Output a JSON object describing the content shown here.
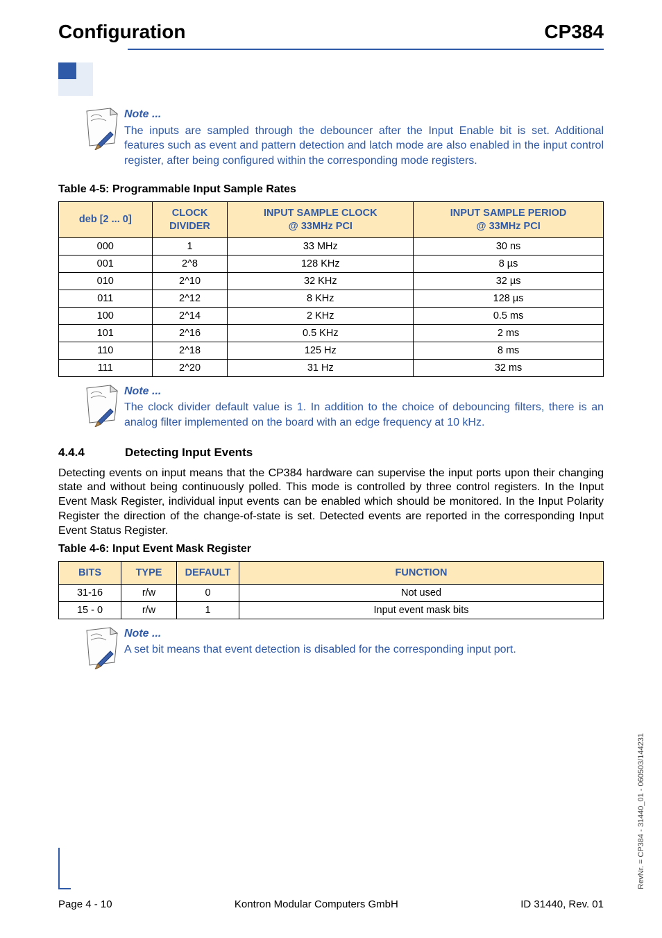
{
  "header": {
    "left": "Configuration",
    "right": "CP384"
  },
  "note1": {
    "head": "Note ...",
    "body": "The inputs are sampled through the debouncer after the Input Enable bit is set. Additional features such as event and pattern detection and latch mode are also enabled in the input control register, after being configured within the corresponding mode registers."
  },
  "table1": {
    "caption": "Table 4-5:  Programmable Input Sample Rates",
    "headers": [
      "deb [2 ... 0]",
      "CLOCK\nDIVIDER",
      "INPUT SAMPLE CLOCK\n@ 33MHz PCI",
      "INPUT SAMPLE PERIOD\n@ 33MHz PCI"
    ],
    "rows": [
      [
        "000",
        "1",
        "33 MHz",
        "30 ns"
      ],
      [
        "001",
        "2^8",
        "128 KHz",
        "8 µs"
      ],
      [
        "010",
        "2^10",
        "32 KHz",
        "32 µs"
      ],
      [
        "011",
        "2^12",
        "8 KHz",
        "128 µs"
      ],
      [
        "100",
        "2^14",
        "2 KHz",
        "0.5 ms"
      ],
      [
        "101",
        "2^16",
        "0.5 KHz",
        "2 ms"
      ],
      [
        "110",
        "2^18",
        "125 Hz",
        "8 ms"
      ],
      [
        "111",
        "2^20",
        "31 Hz",
        "32 ms"
      ]
    ]
  },
  "note2": {
    "head": "Note ...",
    "body": "The clock divider default value is 1. In addition to the choice of debouncing filters, there is an analog filter implemented on the board with an edge frequency at 10 kHz."
  },
  "section": {
    "number": "4.4.4",
    "title": "Detecting Input Events",
    "body": "Detecting events on input means that the CP384 hardware can supervise the input ports upon their changing state and without being continuously polled. This mode is controlled by three control registers. In the Input Event Mask Register, individual input events can be enabled which should be monitored. In the Input Polarity Register the direction of the change-of-state is set. Detected events are reported in the corresponding Input Event Status Register."
  },
  "table2": {
    "caption": "Table 4-6:  Input Event Mask Register",
    "headers": [
      "BITS",
      "TYPE",
      "DEFAULT",
      "FUNCTION"
    ],
    "rows": [
      [
        "31-16",
        "r/w",
        "0",
        "Not used"
      ],
      [
        "15 - 0",
        "r/w",
        "1",
        "Input event mask bits"
      ]
    ]
  },
  "note3": {
    "head": "Note ...",
    "body": "A set bit means that event detection is disabled for the corresponding input port."
  },
  "footer": {
    "left": "Page 4 - 10",
    "center": "Kontron Modular Computers GmbH",
    "right": "ID 31440, Rev. 01"
  },
  "side": "RevNr. = CP384 - 31440_01 - 060503/144231"
}
